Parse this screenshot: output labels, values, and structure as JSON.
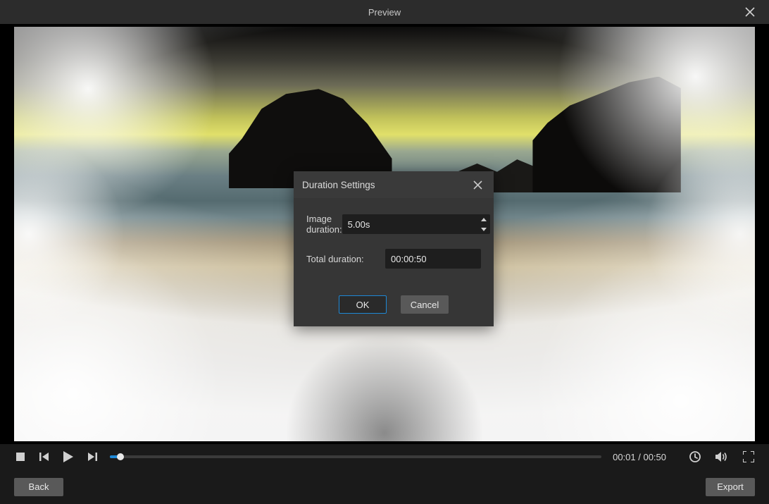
{
  "window": {
    "title": "Preview"
  },
  "modal": {
    "title": "Duration Settings",
    "image_duration_label": "Image duration:",
    "image_duration_value": "5.00s",
    "total_duration_label": "Total duration:",
    "total_duration_value": "00:00:50",
    "ok_label": "OK",
    "cancel_label": "Cancel"
  },
  "player": {
    "time_display": "00:01 / 00:50",
    "progress_percent": 2.2
  },
  "footer": {
    "back_label": "Back",
    "export_label": "Export"
  }
}
